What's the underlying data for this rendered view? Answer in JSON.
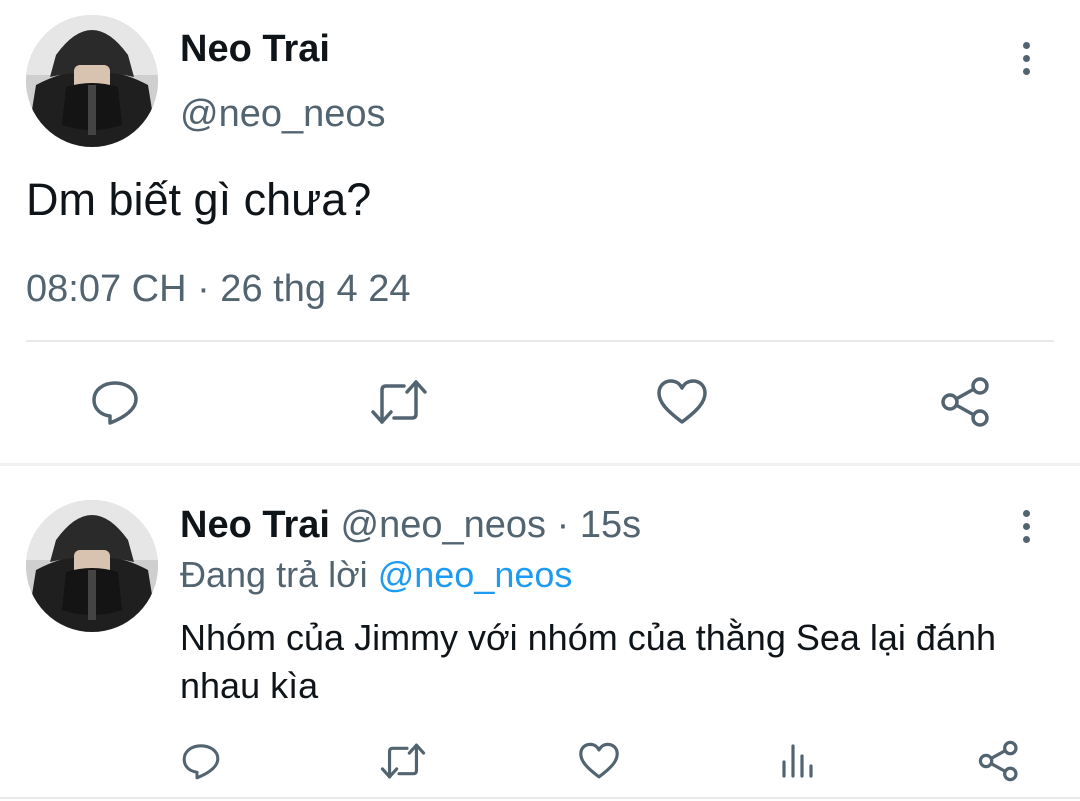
{
  "main_tweet": {
    "author_name": "Neo Trai",
    "author_handle": "@neo_neos",
    "text": "Dm biết gì chưa?",
    "timestamp": "08:07 CH · 26 thg 4 24",
    "actions": {
      "reply_icon": "comment-icon",
      "retweet_icon": "retweet-icon",
      "like_icon": "heart-icon",
      "share_icon": "share-icon"
    }
  },
  "reply_tweet": {
    "author_name": "Neo Trai",
    "author_handle": "@neo_neos",
    "separator": "·",
    "time_ago": "15s",
    "replying_prefix": "Đang trả lời",
    "replying_to": "@neo_neos",
    "text": "Nhóm của Jimmy với nhóm của thằng Sea lại đánh nhau kìa",
    "actions": {
      "reply_icon": "comment-icon",
      "retweet_icon": "retweet-icon",
      "like_icon": "heart-icon",
      "views_icon": "analytics-icon",
      "share_icon": "share-icon"
    }
  },
  "colors": {
    "text_primary": "#0f1419",
    "text_secondary": "#536471",
    "accent": "#1d9bf0",
    "divider": "#e7e9ea"
  }
}
